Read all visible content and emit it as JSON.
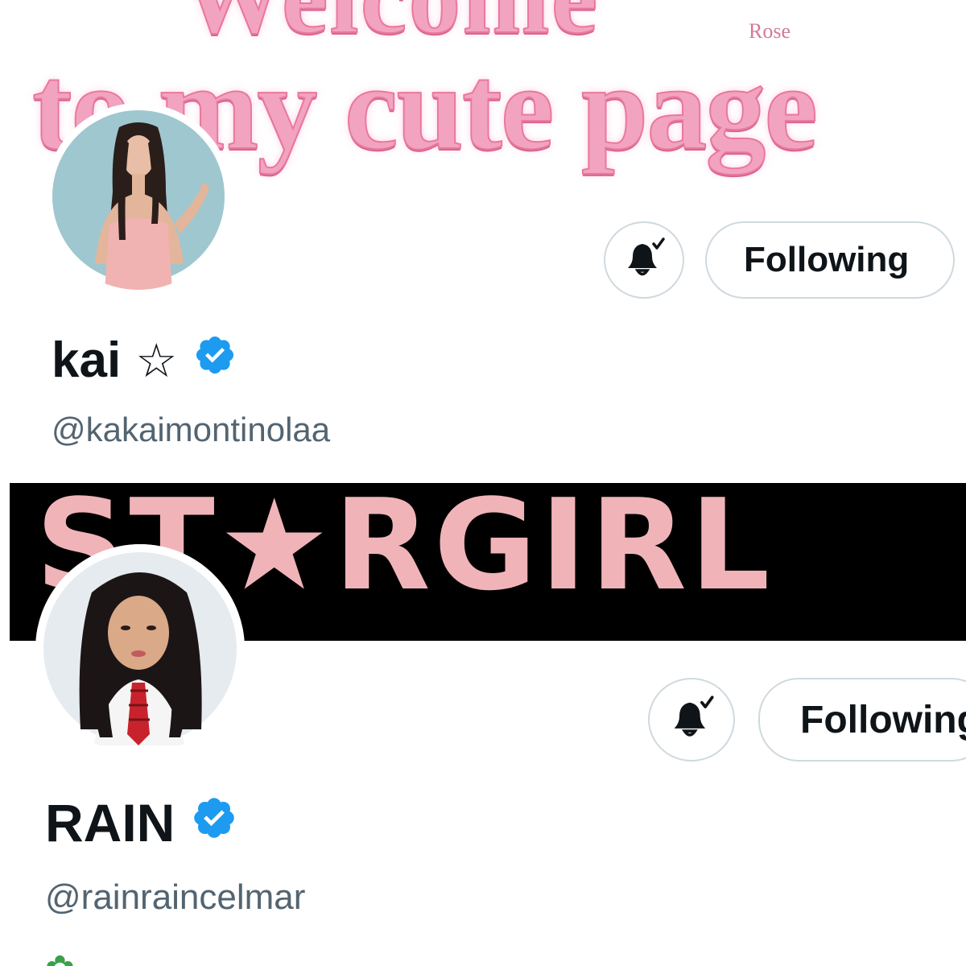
{
  "profiles": [
    {
      "banner": {
        "line_top": "Welcome",
        "line_main": "to my cute page",
        "signature": "Rose"
      },
      "display_name": "kai",
      "name_symbol": "☆",
      "handle": "@kakaimontinolaa",
      "follow_label": "Following",
      "verified": true,
      "notifications_on": true
    },
    {
      "banner": {
        "text": "ST★RGIRL"
      },
      "display_name": "RAIN",
      "handle": "@rainraincelmar",
      "follow_label": "Following",
      "verified": true,
      "notifications_on": true
    }
  ],
  "colors": {
    "verified_blue": "#1d9bf0",
    "text_primary": "#0f1419",
    "text_secondary": "#536471",
    "button_border": "#cfd9de",
    "glitter_pink": "#f2a3c0",
    "stargirl_pink": "#f0b4b8",
    "banner2_bg": "#000000"
  },
  "icons": {
    "bell": "bell-check-icon",
    "verified": "verified-badge-icon"
  }
}
